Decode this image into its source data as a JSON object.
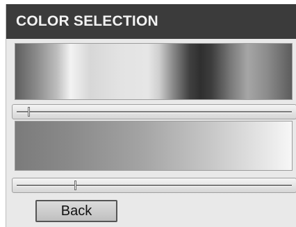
{
  "header": {
    "title": "COLOR SELECTION"
  },
  "hue_slider": {
    "value_fraction": 0.04
  },
  "shade_slider": {
    "value_fraction": 0.21
  },
  "actions": {
    "back_label": "Back"
  },
  "colors": {
    "title_bar_bg": "#3b3b3b",
    "title_text": "#f2f2f2",
    "panel_bg": "#e9e9e9",
    "button_bg": "#c8c8c8"
  }
}
